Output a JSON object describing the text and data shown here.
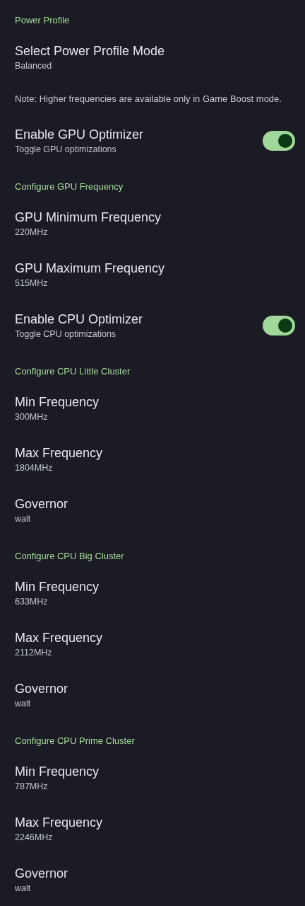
{
  "sections": [
    {
      "title": "Power Profile",
      "items": [
        {
          "kind": "item",
          "title": "Select Power Profile Mode",
          "summary": "Balanced"
        },
        {
          "kind": "note",
          "text": "Note: Higher frequencies are available only in Game Boost mode."
        },
        {
          "kind": "toggle",
          "title": "Enable GPU Optimizer",
          "summary": "Toggle GPU optimizations",
          "on": true
        }
      ]
    },
    {
      "title": "Configure GPU Frequency",
      "items": [
        {
          "kind": "item",
          "title": "GPU Minimum Frequency",
          "summary": "220MHz"
        },
        {
          "kind": "item",
          "title": "GPU Maximum Frequency",
          "summary": "515MHz"
        },
        {
          "kind": "toggle",
          "title": "Enable CPU Optimizer",
          "summary": "Toggle CPU optimizations",
          "on": true
        }
      ]
    },
    {
      "title": "Configure CPU Little Cluster",
      "items": [
        {
          "kind": "item",
          "title": "Min Frequency",
          "summary": "300MHz"
        },
        {
          "kind": "item",
          "title": "Max Frequency",
          "summary": "1804MHz"
        },
        {
          "kind": "item",
          "title": "Governor",
          "summary": "walt"
        }
      ]
    },
    {
      "title": "Configure CPU Big Cluster",
      "items": [
        {
          "kind": "item",
          "title": "Min Frequency",
          "summary": "633MHz"
        },
        {
          "kind": "item",
          "title": "Max Frequency",
          "summary": "2112MHz"
        },
        {
          "kind": "item",
          "title": "Governor",
          "summary": "walt"
        }
      ]
    },
    {
      "title": "Configure CPU Prime Cluster",
      "items": [
        {
          "kind": "item",
          "title": "Min Frequency",
          "summary": "787MHz"
        },
        {
          "kind": "item",
          "title": "Max Frequency",
          "summary": "2246MHz"
        },
        {
          "kind": "item",
          "title": "Governor",
          "summary": "walt"
        }
      ]
    }
  ]
}
